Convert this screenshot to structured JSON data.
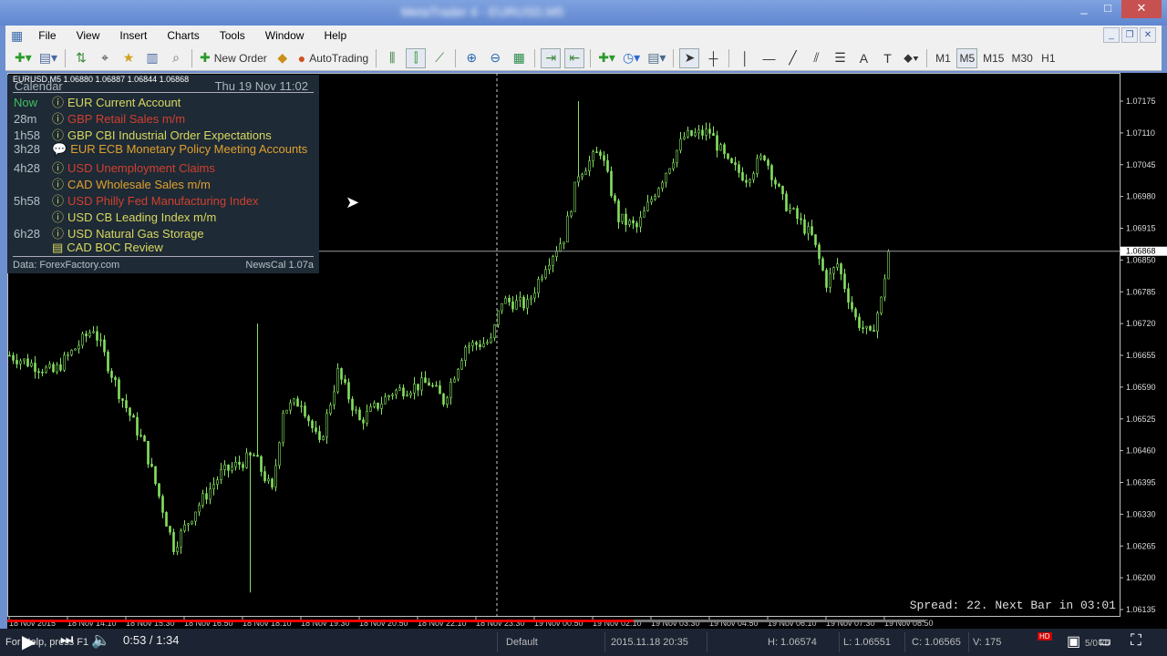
{
  "window": {
    "title": "MetaTrader 4 - EURUSD,M5",
    "buttons": [
      "_",
      "□",
      "✕"
    ]
  },
  "menu": [
    "File",
    "View",
    "Insert",
    "Charts",
    "Tools",
    "Window",
    "Help"
  ],
  "toolbar": {
    "new_order": "New Order",
    "autotrading": "AutoTrading",
    "timeframes": [
      "M1",
      "M5",
      "M15",
      "M30",
      "H1"
    ],
    "active_timeframe": "M5"
  },
  "calendar": {
    "symbol_line": "EURUSD,M5  1.06880 1.06887 1.06844 1.06868",
    "title": "Calendar",
    "datetime": "Thu 19 Nov 11:02",
    "events": [
      {
        "time": "Now",
        "icon": "info-icon",
        "text": "EUR Current Account",
        "color": "#d8d860"
      },
      {
        "time": "28m",
        "icon": "info-icon",
        "text": "GBP Retail Sales m/m",
        "color": "#d04030"
      },
      {
        "time": "1h58",
        "icon": "info-icon",
        "text": "GBP CBI Industrial Order Expectations",
        "color": "#d8d860"
      },
      {
        "time": "3h28",
        "icon": "speech-icon",
        "text": "EUR ECB Monetary Policy Meeting Accounts",
        "color": "#e0a030"
      },
      {
        "time": "4h28",
        "icon": "info-icon",
        "text": "USD Unemployment Claims",
        "color": "#d04030"
      },
      {
        "time": "",
        "icon": "info-icon",
        "text": "CAD Wholesale Sales m/m",
        "color": "#e0a030"
      },
      {
        "time": "5h58",
        "icon": "info-icon",
        "text": "USD Philly Fed Manufacturing Index",
        "color": "#d04030"
      },
      {
        "time": "",
        "icon": "info-icon",
        "text": "USD CB Leading Index m/m",
        "color": "#d8d860"
      },
      {
        "time": "6h28",
        "icon": "info-icon",
        "text": "USD Natural Gas Storage",
        "color": "#d8d860"
      },
      {
        "time": "",
        "icon": "document-icon",
        "text": "CAD BOC Review",
        "color": "#d8d860"
      }
    ],
    "source": "Data: ForexFactory.com",
    "version": "NewsCal 1.07a"
  },
  "chart_data": {
    "type": "candlestick",
    "symbol": "EURUSD",
    "timeframe": "M5",
    "ylim": [
      1.06135,
      1.07175
    ],
    "yticks": [
      "1.07175",
      "1.07110",
      "1.07045",
      "1.06980",
      "1.06915",
      "1.06850",
      "1.06785",
      "1.06720",
      "1.06655",
      "1.06590",
      "1.06525",
      "1.06460",
      "1.06395",
      "1.06330",
      "1.06265",
      "1.06200",
      "1.06135"
    ],
    "current_price": "1.06868",
    "xticks": [
      "18 Nov 2015",
      "18 Nov 14:10",
      "18 Nov 15:30",
      "18 Nov 16:50",
      "18 Nov 18:10",
      "18 Nov 19:30",
      "18 Nov 20:50",
      "18 Nov 22:10",
      "18 Nov 23:30",
      "19 Nov 00:50",
      "19 Nov 02:10",
      "19 Nov 03:30",
      "19 Nov 04:50",
      "19 Nov 06:10",
      "19 Nov 07:30",
      "19 Nov 08:50"
    ],
    "price_path": [
      [
        "18 Nov 12:50",
        1.06655
      ],
      [
        "18 Nov 13:50",
        1.0662
      ],
      [
        "18 Nov 14:45",
        1.06711
      ],
      [
        "18 Nov 15:20",
        1.0658
      ],
      [
        "18 Nov 15:55",
        1.0647
      ],
      [
        "18 Nov 16:35",
        1.06264
      ],
      [
        "18 Nov 17:05",
        1.0634
      ],
      [
        "18 Nov 17:40",
        1.06413
      ],
      [
        "18 Nov 18:25",
        1.0645
      ],
      [
        "18 Nov 18:50",
        1.06376
      ],
      [
        "18 Nov 19:05",
        1.06544
      ],
      [
        "18 Nov 19:30",
        1.06562
      ],
      [
        "18 Nov 19:55",
        1.0647
      ],
      [
        "18 Nov 20:20",
        1.0662
      ],
      [
        "18 Nov 20:50",
        1.0652
      ],
      [
        "18 Nov 21:35",
        1.0658
      ],
      [
        "18 Nov 22:25",
        1.06599
      ],
      [
        "18 Nov 22:45",
        1.06562
      ],
      [
        "18 Nov 23:15",
        1.06674
      ],
      [
        "18 Nov 23:50",
        1.06683
      ],
      [
        "19 Nov 00:05",
        1.06767
      ],
      [
        "19 Nov 00:40",
        1.06758
      ],
      [
        "19 Nov 01:05",
        1.06842
      ],
      [
        "19 Nov 01:30",
        1.06897
      ],
      [
        "19 Nov 01:50",
        1.07028
      ],
      [
        "19 Nov 02:20",
        1.07074
      ],
      [
        "19 Nov 02:45",
        1.06935
      ],
      [
        "19 Nov 03:10",
        1.06916
      ],
      [
        "19 Nov 03:35",
        1.0699
      ],
      [
        "19 Nov 04:15",
        1.07102
      ],
      [
        "19 Nov 04:50",
        1.07112
      ],
      [
        "19 Nov 05:15",
        1.07046
      ],
      [
        "19 Nov 05:40",
        1.07019
      ],
      [
        "19 Nov 06:05",
        1.07065
      ],
      [
        "19 Nov 06:30",
        1.06972
      ],
      [
        "19 Nov 07:10",
        1.06897
      ],
      [
        "19 Nov 07:30",
        1.06804
      ],
      [
        "19 Nov 07:45",
        1.06842
      ],
      [
        "19 Nov 08:10",
        1.0673
      ],
      [
        "19 Nov 08:30",
        1.06693
      ],
      [
        "19 Nov 08:45",
        1.06767
      ],
      [
        "19 Nov 08:55",
        1.06868
      ]
    ],
    "spikes": [
      [
        "18 Nov 18:20",
        1.0617
      ],
      [
        "18 Nov 18:30",
        1.0672
      ],
      [
        "19 Nov 01:50",
        1.07175
      ]
    ],
    "candle_color": "#86e060",
    "grid": false,
    "overlay_text": "Spread: 22. Next Bar in 03:01"
  },
  "status": {
    "help": "For Help, press F1",
    "profile": "Default",
    "datetime": "2015.11.18 20:35",
    "high": "H: 1.06574",
    "low": "L: 1.06551",
    "close": "C: 1.06565",
    "volume": "V: 175",
    "traffic": "5/0 kb"
  },
  "video": {
    "time": "0:53 / 1:34",
    "progress": 0.563,
    "hd": "HD"
  }
}
